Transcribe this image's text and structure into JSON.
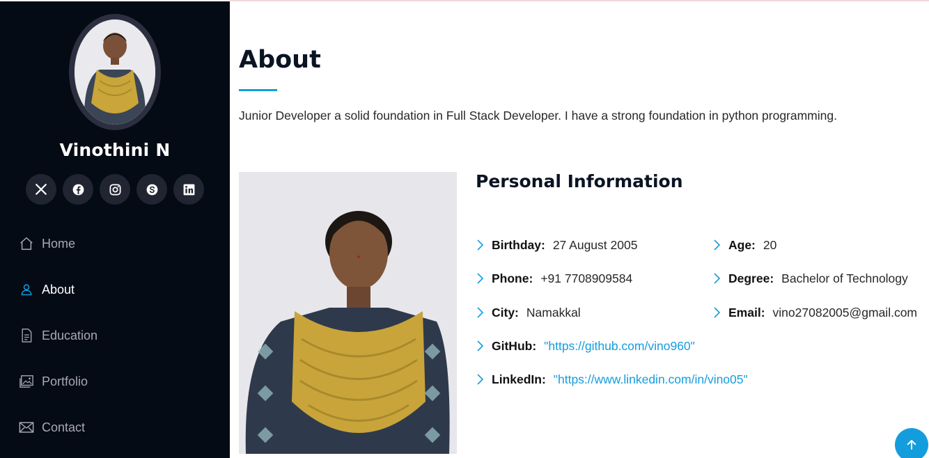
{
  "sidebar": {
    "name": "Vinothini N",
    "socials": [
      {
        "icon": "x-twitter-icon"
      },
      {
        "icon": "facebook-icon"
      },
      {
        "icon": "instagram-icon"
      },
      {
        "icon": "skype-icon"
      },
      {
        "icon": "linkedin-icon"
      }
    ],
    "nav": [
      {
        "label": "Home",
        "icon": "home-icon",
        "active": false
      },
      {
        "label": "About",
        "icon": "person-icon",
        "active": true
      },
      {
        "label": "Education",
        "icon": "document-icon",
        "active": false
      },
      {
        "label": "Portfolio",
        "icon": "images-icon",
        "active": false
      },
      {
        "label": "Contact",
        "icon": "envelope-icon",
        "active": false
      }
    ]
  },
  "about": {
    "title": "About",
    "intro": "Junior Developer a solid foundation in Full Stack Developer. I have a strong foundation in python programming.",
    "info_heading": "Personal Information",
    "fields": {
      "birthday": {
        "label": "Birthday:",
        "value": "27 August 2005"
      },
      "phone": {
        "label": "Phone:",
        "value": "+91 7708909584"
      },
      "city": {
        "label": "City:",
        "value": "Namakkal"
      },
      "github": {
        "label": "GitHub:",
        "value": "\"https://github.com/vino960\""
      },
      "linkedin": {
        "label": "LinkedIn:",
        "value": "\"https://www.linkedin.com/in/vino05\""
      },
      "age": {
        "label": "Age:",
        "value": "20"
      },
      "degree": {
        "label": "Degree:",
        "value": "Bachelor of Technology"
      },
      "email": {
        "label": "Email:",
        "value": "vino27082005@gmail.com"
      }
    }
  },
  "colors": {
    "sidebar_bg": "#040b14",
    "accent": "#149ddd",
    "social_bg": "#212431",
    "nav_text": "#a8a9b4"
  }
}
